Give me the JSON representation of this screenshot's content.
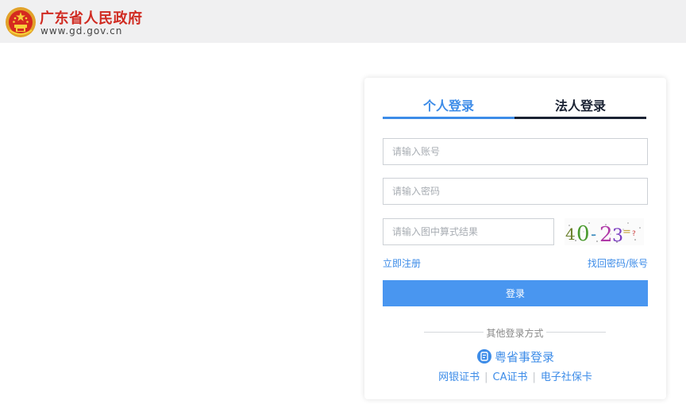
{
  "header": {
    "title": "广东省人民政府",
    "url": "www.gd.gov.cn",
    "emblem_icon": "national-emblem-icon"
  },
  "login": {
    "tabs": [
      {
        "label": "个人登录",
        "active": true
      },
      {
        "label": "法人登录",
        "active": false
      }
    ],
    "account_placeholder": "请输入账号",
    "password_placeholder": "请输入密码",
    "captcha_placeholder": "请输入图中算式结果",
    "captcha_text": "40-23=?",
    "register_link": "立即注册",
    "forgot_link": "找回密码/账号",
    "submit_label": "登录",
    "other_methods_label": "其他登录方式",
    "yuesheng_label": "粤省事登录",
    "yuesheng_icon": "yuesheng-app-icon",
    "alt_methods": [
      "网银证书",
      "CA证书",
      "电子社保卡"
    ],
    "separator": "|"
  },
  "colors": {
    "brand_red": "#d02b22",
    "accent_blue": "#3d8ce8",
    "button_blue": "#4996f0",
    "header_bg": "#f0f0f1"
  }
}
